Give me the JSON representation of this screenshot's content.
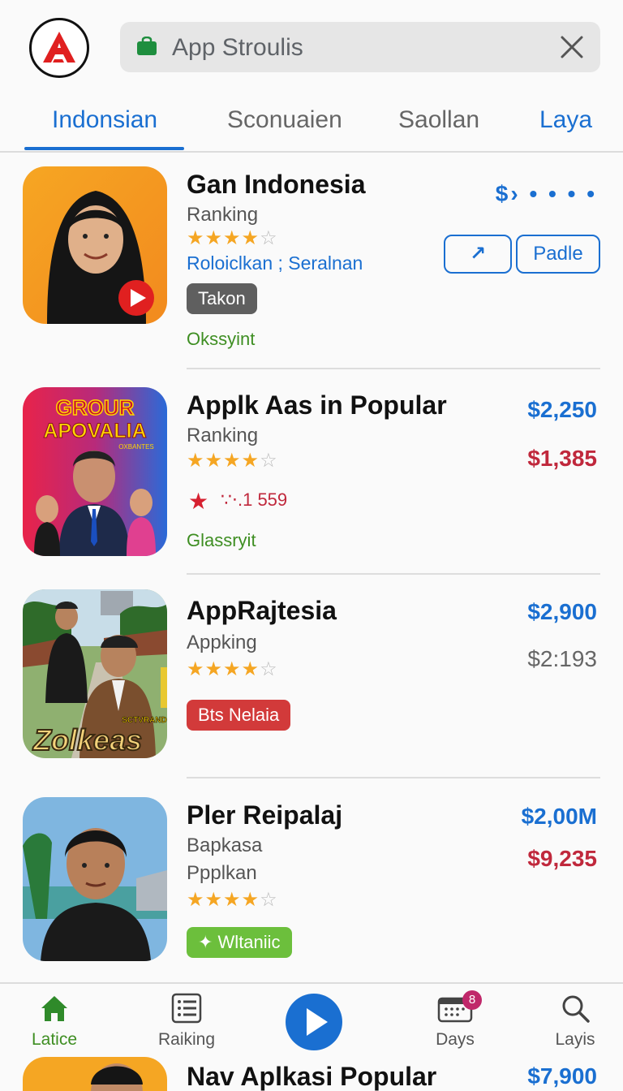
{
  "search": {
    "text": "App Stroulis"
  },
  "tabs": [
    {
      "label": "Indonsian",
      "active": true
    },
    {
      "label": "Sconuaien",
      "active": false
    },
    {
      "label": "Saollan",
      "active": false
    },
    {
      "label": "Laya",
      "active": false
    }
  ],
  "items": [
    {
      "title": "Gan Indonesia",
      "subtitle": "Ranking",
      "rating": 4,
      "link_text": "Roloiclkan ; Seralnan",
      "badge": "Takon",
      "footer": "Okssyint",
      "price": "$› • • • •",
      "action_icon_button": "↗",
      "action_button": "Padle"
    },
    {
      "title": "Applk Aas in Popular",
      "subtitle": "Ranking",
      "rating": 4,
      "stat_text": "∵⋅.1  559",
      "footer": "Glassryit",
      "thumb_text_top": "GROUR",
      "thumb_text_bottom": "APOVALIA",
      "thumb_text_small": "OXBANTES",
      "price1": "$2,250",
      "price2": "$1,385"
    },
    {
      "title": "AppRajtesia",
      "subtitle": "Appking",
      "rating": 4,
      "badge": "Bts Nelaia",
      "thumb_text": "Zolkeas",
      "thumb_text_small": "SCTVRAND",
      "price1": "$2,900",
      "price2": "$2:193"
    },
    {
      "title": "Pler Reipalaj",
      "subtitle": "Bapkasa",
      "subtitle2": "Ppplkan",
      "rating": 4,
      "badge": "✦ Wltaniic",
      "price1": "$2,00M",
      "price2": "$9,235"
    }
  ],
  "nav": [
    {
      "label": "Latice",
      "icon": "home-icon",
      "active": true
    },
    {
      "label": "Raiking",
      "icon": "list-icon",
      "active": false
    },
    {
      "label": "",
      "icon": "play-icon",
      "active": false
    },
    {
      "label": "Days",
      "icon": "calendar-icon",
      "active": false,
      "badge": "8"
    },
    {
      "label": "Layis",
      "icon": "search-icon",
      "active": false
    }
  ],
  "peek": {
    "title": "Nav Aplkasi Popular",
    "price": "$7,900"
  },
  "colors": {
    "accent": "#1a6fd1",
    "price_red": "#c0283c",
    "nav_active": "#3e8e22",
    "star": "#f5a623",
    "logo_red": "#e02020"
  }
}
